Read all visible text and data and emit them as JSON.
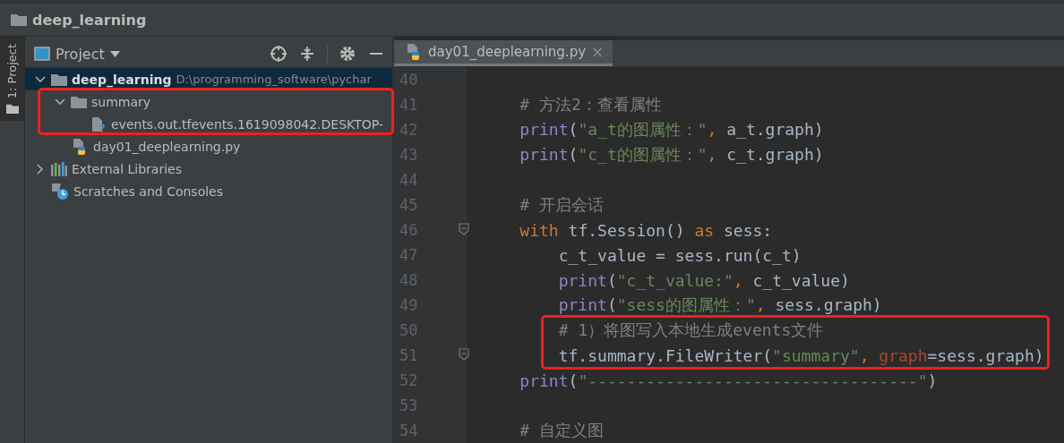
{
  "title_bar": {
    "project_name": "deep_learning"
  },
  "tool_strip": {
    "label": "1: Project",
    "selected": true
  },
  "project_panel": {
    "title": "Project",
    "tree": [
      {
        "label": "deep_learning",
        "path": "D:\\programming_software\\pychar",
        "kind": "folder",
        "expanded": true,
        "selected": true,
        "children": [
          {
            "label": "summary",
            "kind": "folder",
            "expanded": true,
            "selected": false,
            "children": [
              {
                "label": "events.out.tfevents.1619098042.DESKTOP-",
                "kind": "unknown-file",
                "selected": false
              }
            ]
          },
          {
            "label": "day01_deeplearning.py",
            "kind": "python-file",
            "selected": false
          }
        ]
      },
      {
        "label": "External Libraries",
        "kind": "libraries",
        "expanded": false,
        "selected": false
      },
      {
        "label": "Scratches and Consoles",
        "kind": "scratches",
        "selected": false
      }
    ]
  },
  "editor": {
    "tabs": [
      {
        "label": "day01_deeplearning.py",
        "close": "×",
        "selected": true
      }
    ],
    "lines": [
      {
        "number": "40",
        "fold": false
      },
      {
        "number": "41",
        "fold": false,
        "tokens": [
          {
            "text": "    # 方法2：查看属性",
            "kind": "comment"
          }
        ]
      },
      {
        "number": "42",
        "fold": false,
        "tokens": [
          {
            "text": "    print",
            "kind": "builtin"
          },
          {
            "text": "(",
            "kind": "plain"
          },
          {
            "text": "\"a_t的图属性：\"",
            "kind": "string"
          },
          {
            "text": ", ",
            "kind": "keyword"
          },
          {
            "text": "a_t.graph)",
            "kind": "plain"
          }
        ]
      },
      {
        "number": "43",
        "fold": false,
        "tokens": [
          {
            "text": "    print",
            "kind": "builtin"
          },
          {
            "text": "(",
            "kind": "plain"
          },
          {
            "text": "\"c_t的图属性：\"",
            "kind": "string"
          },
          {
            "text": ", ",
            "kind": "keyword"
          },
          {
            "text": "c_t.graph)",
            "kind": "plain"
          }
        ]
      },
      {
        "number": "44",
        "fold": false
      },
      {
        "number": "45",
        "fold": false,
        "tokens": [
          {
            "text": "    # 开启会话",
            "kind": "comment"
          }
        ]
      },
      {
        "number": "46",
        "fold": true,
        "tokens": [
          {
            "text": "    with ",
            "kind": "keyword"
          },
          {
            "text": "tf.Session() ",
            "kind": "plain"
          },
          {
            "text": "as ",
            "kind": "keyword"
          },
          {
            "text": "sess:",
            "kind": "plain"
          }
        ]
      },
      {
        "number": "47",
        "fold": false,
        "tokens": [
          {
            "text": "        c_t_value = sess.run(c_t)",
            "kind": "plain"
          }
        ]
      },
      {
        "number": "48",
        "fold": false,
        "tokens": [
          {
            "text": "        print",
            "kind": "builtin"
          },
          {
            "text": "(",
            "kind": "plain"
          },
          {
            "text": "\"c_t_value:\"",
            "kind": "string"
          },
          {
            "text": ", ",
            "kind": "keyword"
          },
          {
            "text": "c_t_value)",
            "kind": "plain"
          }
        ]
      },
      {
        "number": "49",
        "fold": false,
        "tokens": [
          {
            "text": "        print",
            "kind": "builtin"
          },
          {
            "text": "(",
            "kind": "plain"
          },
          {
            "text": "\"sess的图属性：\"",
            "kind": "string"
          },
          {
            "text": ", ",
            "kind": "keyword"
          },
          {
            "text": "sess.graph)",
            "kind": "plain"
          }
        ]
      },
      {
        "number": "50",
        "fold": false,
        "tokens": [
          {
            "text": "        # 1）将图写入本地生成events文件",
            "kind": "comment"
          }
        ]
      },
      {
        "number": "51",
        "fold": true,
        "tokens": [
          {
            "text": "        tf.summary.FileWriter(",
            "kind": "plain"
          },
          {
            "text": "\"summary\"",
            "kind": "string"
          },
          {
            "text": ", ",
            "kind": "keyword"
          },
          {
            "text": "graph",
            "kind": "param"
          },
          {
            "text": "=sess.graph)",
            "kind": "plain"
          }
        ]
      },
      {
        "number": "52",
        "fold": false,
        "tokens": [
          {
            "text": "    print",
            "kind": "builtin"
          },
          {
            "text": "(",
            "kind": "plain"
          },
          {
            "text": "\"----------------------------------\"",
            "kind": "string"
          },
          {
            "text": ")",
            "kind": "plain"
          }
        ]
      },
      {
        "number": "53",
        "fold": false
      },
      {
        "number": "54",
        "fold": false,
        "tokens": [
          {
            "text": "    # 自定义图",
            "kind": "comment"
          }
        ]
      }
    ]
  }
}
